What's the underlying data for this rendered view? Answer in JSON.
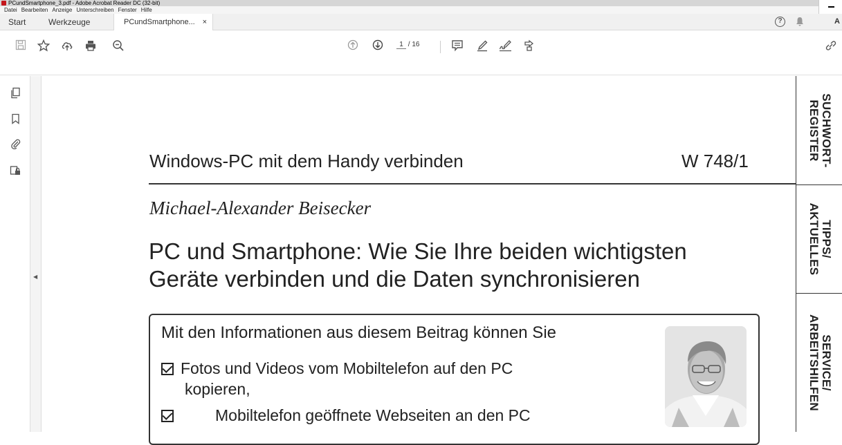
{
  "window": {
    "title": "PCundSmartphone_3.pdf - Adobe Acrobat Reader DC (32-bit)"
  },
  "menu": {
    "items": [
      "Datei",
      "Bearbeiten",
      "Anzeige",
      "Unterschreiben",
      "Fenster",
      "Hilfe"
    ]
  },
  "tabs": {
    "start": "Start",
    "tools": "Werkzeuge",
    "document": "PCundSmartphone...",
    "close_glyph": "×",
    "help_glyph": "?",
    "account_glyph": "A"
  },
  "toolbar": {
    "current_page": "1",
    "page_total": "/ 16"
  },
  "document": {
    "running_head": "Windows-PC mit dem Handy verbinden",
    "section_number": "W 748/1",
    "author": "Michael-Alexander Beisecker",
    "headline_line1": "PC und Smartphone: Wie Sie Ihre beiden wichtigsten",
    "headline_line2": "Geräte verbinden und die Daten synchronisieren",
    "box_heading": "Mit den Informationen aus diesem Beitrag können Sie",
    "box_item1_line1": "Fotos und Videos vom Mobiltelefon auf den PC",
    "box_item1_line2": "kopieren,",
    "box_item2_partial": "Mobiltelefon geöffnete Webseiten an den PC"
  },
  "side_tabs": {
    "tab1_line1": "SUCHWORT-",
    "tab1_line2": "REGISTER",
    "tab2_line1": "TIPPS/",
    "tab2_line2": "AKTUELLES",
    "tab3_line1": "SERVICE/",
    "tab3_line2": "ARBEITSHILFEN"
  },
  "colors": {
    "acrobat_red": "#c4161c",
    "toolbar_icon": "#555555",
    "page_text": "#222222"
  }
}
